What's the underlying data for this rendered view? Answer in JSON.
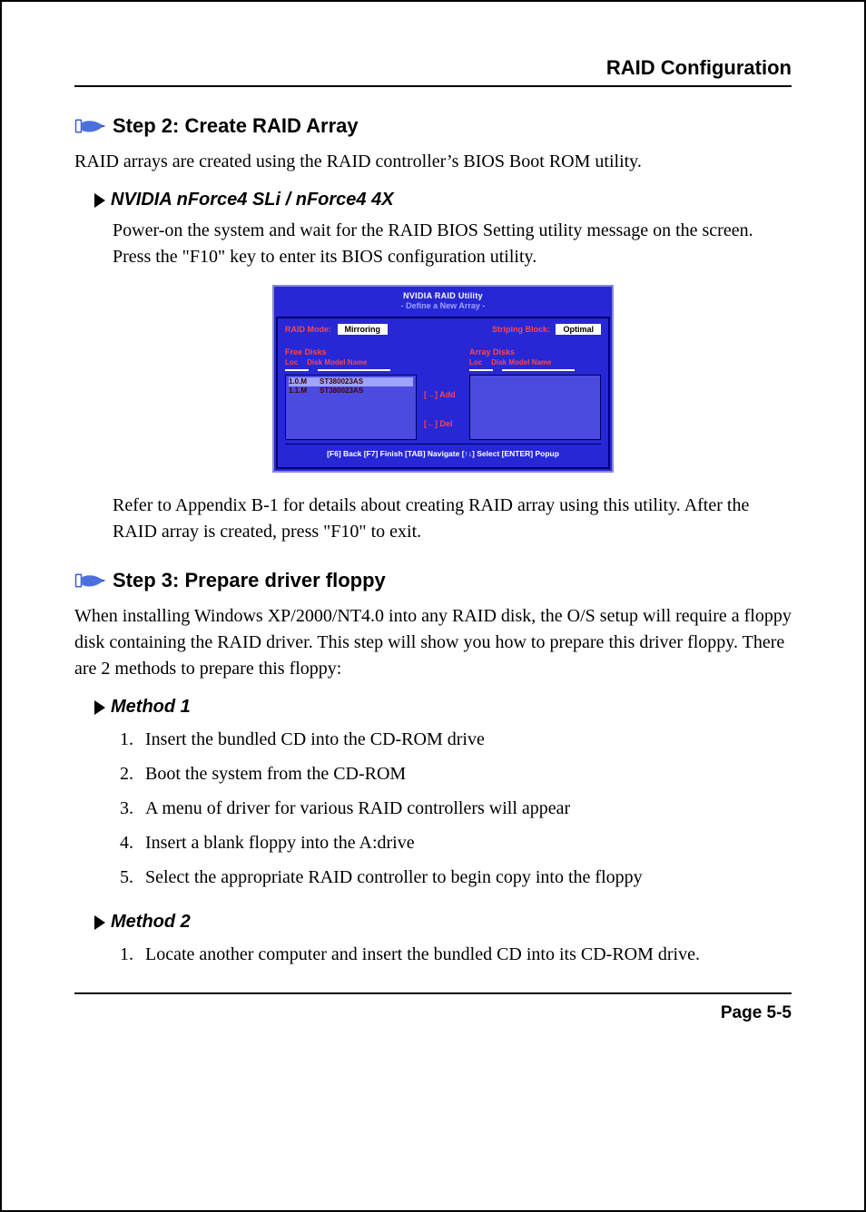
{
  "header": {
    "title": "RAID Configuration"
  },
  "step2": {
    "heading": "Step 2: Create RAID Array",
    "intro": "RAID arrays are created using the RAID controller’s BIOS Boot ROM utility.",
    "sub1_title": "NVIDIA nForce4 SLi / nForce4 4X",
    "sub1_p1": "Power-on the system and wait for the RAID BIOS Setting utility message on the screen.  Press the \"F10\" key to enter its BIOS configuration utility.",
    "after_img": "Refer to Appendix B-1 for details about creating RAID array using this utility. After the RAID array is created, press \"F10\" to exit."
  },
  "raid_util": {
    "title": "NVIDIA RAID Utility",
    "subtitle": "- Define a New Array -",
    "mode_label": "RAID Mode:",
    "mode_value": "Mirroring",
    "block_label": "Striping Block:",
    "block_value": "Optimal",
    "free_label": "Free Disks",
    "array_label": "Array Disks",
    "col_loc": "Loc",
    "col_model": "Disk Model Name",
    "btn_add": "[→] Add",
    "btn_del": "[←] Del",
    "free_rows": [
      {
        "loc": "1.0.M",
        "name": "ST380023AS"
      },
      {
        "loc": "1.1.M",
        "name": "ST380023AS"
      }
    ],
    "footer": "[F6] Back  [F7] Finish  [TAB] Navigate  [↑↓] Select  [ENTER] Popup"
  },
  "step3": {
    "heading": "Step 3: Prepare driver floppy",
    "intro": "When installing Windows XP/2000/NT4.0 into any RAID disk, the O/S setup will require a floppy disk containing the RAID driver. This step will show you how to prepare this driver floppy. There are 2 methods to prepare this floppy:",
    "method1_title": "Method 1",
    "method1_items": [
      "Insert the bundled CD into the CD-ROM drive",
      "Boot the system from the CD-ROM",
      "A menu of driver for various RAID controllers will appear",
      "Insert a blank floppy into the A:drive",
      "Select the appropriate RAID controller to begin copy into the floppy"
    ],
    "method2_title": "Method 2",
    "method2_items": [
      "Locate another computer and insert the bundled CD into its CD-ROM drive."
    ]
  },
  "footer": {
    "page": "Page 5-5"
  }
}
